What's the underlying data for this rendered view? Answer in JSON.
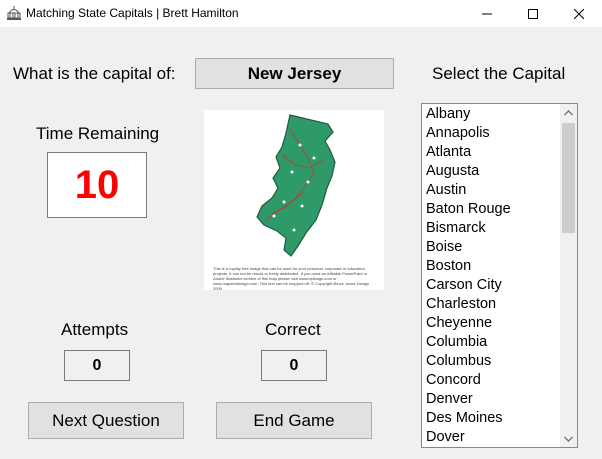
{
  "window": {
    "title": "Matching State Capitals  | Brett Hamilton",
    "icon": "capitol-building-icon"
  },
  "question": {
    "prompt": "What is the capital of:",
    "state": "New Jersey"
  },
  "timer": {
    "label": "Time Remaining",
    "value": "10",
    "color": "#ff0000"
  },
  "map": {
    "image": "new-jersey-map",
    "fill_color": "#2e9a6a",
    "caption": "This is a royalty free image that can be used for your personal, corporate or education projects. It can not be resold or freely distributed. If you need an editable PowerPoint or Adobe Illustrator version of this map please visit www.bjdesign.com or www.mapsfordesign.com.  This text can be cropped off.  © Copyright Bruce Jones Design 2009"
  },
  "stats": {
    "attempts_label": "Attempts",
    "attempts_value": "0",
    "correct_label": "Correct",
    "correct_value": "0"
  },
  "buttons": {
    "next_question": "Next Question",
    "end_game": "End Game"
  },
  "capitals": {
    "label": "Select the Capital",
    "items": [
      "Albany",
      "Annapolis",
      "Atlanta",
      "Augusta",
      "Austin",
      "Baton Rouge",
      "Bismarck",
      "Boise",
      "Boston",
      "Carson City",
      "Charleston",
      "Cheyenne",
      "Columbia",
      "Columbus",
      "Concord",
      "Denver",
      "Des Moines",
      "Dover"
    ]
  }
}
